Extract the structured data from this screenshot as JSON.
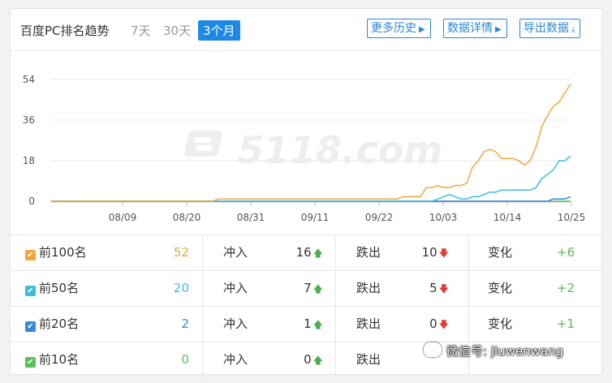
{
  "header": {
    "title": "百度PC排名趋势",
    "tabs": [
      {
        "label": "7天",
        "active": false
      },
      {
        "label": "30天",
        "active": false
      },
      {
        "label": "3个月",
        "active": true
      }
    ],
    "buttons": [
      {
        "label": "更多历史",
        "icon": "caret-right-icon"
      },
      {
        "label": "数据详情",
        "icon": "caret-right-icon"
      },
      {
        "label": "导出数据",
        "icon": "download-icon"
      }
    ]
  },
  "watermark": "5118.com",
  "chart_data": {
    "type": "line",
    "x_ticks": [
      "08/09",
      "08/20",
      "08/31",
      "09/11",
      "09/22",
      "10/03",
      "10/14",
      "10/25"
    ],
    "y_ticks": [
      0,
      18,
      36,
      54
    ],
    "ylim": [
      0,
      54
    ],
    "series": [
      {
        "name": "前100名",
        "color": "#f0a73a",
        "x": [
          0,
          28,
          29,
          30,
          31,
          60,
          61,
          62,
          63,
          64,
          65,
          66,
          67,
          68,
          69,
          70,
          71,
          72,
          73,
          74,
          75,
          76,
          77,
          78,
          79,
          80,
          81,
          82,
          83,
          84,
          85,
          86,
          87,
          88,
          89,
          90
        ],
        "values": [
          0,
          0,
          1,
          1,
          1,
          1,
          2,
          2,
          2,
          2,
          6,
          6,
          7,
          6,
          6,
          7,
          7,
          8,
          15,
          18,
          22,
          23,
          22,
          19,
          19,
          19,
          18,
          16,
          18,
          24,
          33,
          38,
          42,
          44,
          48,
          52
        ]
      },
      {
        "name": "前50名",
        "color": "#3dbbe0",
        "x": [
          0,
          66,
          67,
          68,
          69,
          70,
          71,
          72,
          73,
          74,
          75,
          76,
          77,
          78,
          79,
          80,
          81,
          82,
          83,
          84,
          85,
          86,
          87,
          88,
          89,
          90
        ],
        "values": [
          0,
          0,
          1,
          2,
          3,
          2,
          1,
          1,
          2,
          2,
          3,
          4,
          4,
          5,
          5,
          5,
          5,
          5,
          5,
          6,
          10,
          12,
          14,
          18,
          18,
          20
        ]
      },
      {
        "name": "前20名",
        "color": "#3a87d9",
        "x": [
          0,
          86,
          87,
          88,
          89,
          90
        ],
        "values": [
          0,
          0,
          1,
          1,
          1,
          2
        ]
      },
      {
        "name": "前10名",
        "color": "#5cbd5c",
        "x": [
          0,
          90
        ],
        "values": [
          0,
          0
        ]
      }
    ]
  },
  "table": {
    "rows": [
      {
        "label": "前100名",
        "value": "52",
        "value_color": "#f0a73a",
        "check_color": "#f0a73a",
        "in_label": "冲入",
        "in_value": "16",
        "out_label": "跌出",
        "out_value": "10",
        "change_label": "变化",
        "change_value": "+6"
      },
      {
        "label": "前50名",
        "value": "20",
        "value_color": "#3dbbe0",
        "check_color": "#3dbbe0",
        "in_label": "冲入",
        "in_value": "7",
        "out_label": "跌出",
        "out_value": "5",
        "change_label": "变化",
        "change_value": "+2"
      },
      {
        "label": "前20名",
        "value": "2",
        "value_color": "#3a87d9",
        "check_color": "#3a87d9",
        "in_label": "冲入",
        "in_value": "1",
        "out_label": "跌出",
        "out_value": "0",
        "change_label": "变化",
        "change_value": "+1"
      },
      {
        "label": "前10名",
        "value": "0",
        "value_color": "#5cbd5c",
        "check_color": "#5cbd5c",
        "in_label": "冲入",
        "in_value": "0",
        "out_label": "跌出",
        "out_value": "",
        "change_label": "",
        "change_value": ""
      }
    ]
  },
  "overlay": {
    "wechat_text": "微信号: jiuwenwang"
  }
}
